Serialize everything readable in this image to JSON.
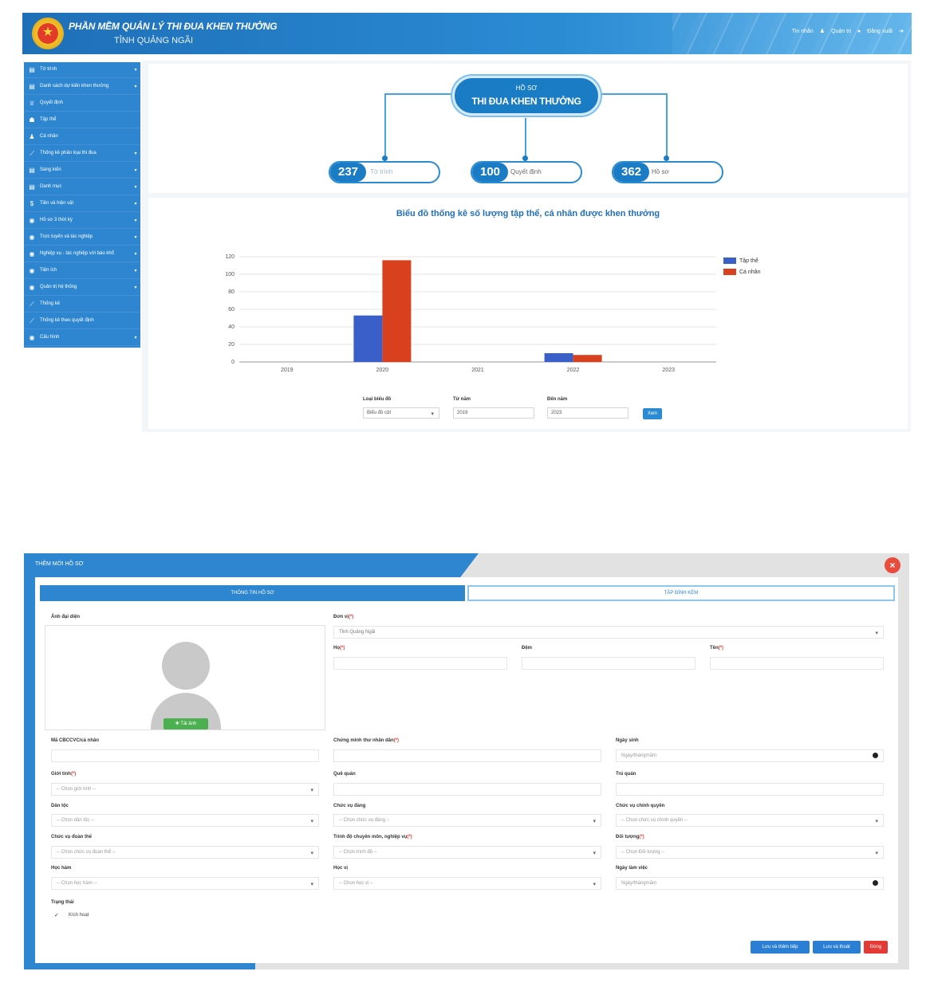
{
  "header": {
    "app_title": "PHẦN MỀM QUẢN LÝ THI ĐUA KHEN THƯỞNG",
    "app_subtitle": "TỈNH QUẢNG NGÃI",
    "nav": [
      "Tin nhắn",
      "Quản trị",
      "Đăng xuất"
    ]
  },
  "sidebar": {
    "items": [
      {
        "icon": "document-icon",
        "glyph": "▤",
        "label": "Tờ trình",
        "has_children": true
      },
      {
        "icon": "document-icon",
        "glyph": "▤",
        "label": "Danh sách dự kiến khen thưởng",
        "has_children": true
      },
      {
        "icon": "trophy-icon",
        "glyph": "♕",
        "label": "Quyết định",
        "has_children": false
      },
      {
        "icon": "group-icon",
        "glyph": "☗",
        "label": "Tập thể",
        "has_children": false
      },
      {
        "icon": "user-icon",
        "glyph": "♟",
        "label": "Cá nhân",
        "has_children": false
      },
      {
        "icon": "chart-icon",
        "glyph": "⟋",
        "label": "Thống kê phân loại thi đua",
        "has_children": true
      },
      {
        "icon": "file-icon",
        "glyph": "▤",
        "label": "Sáng kiến",
        "has_children": true
      },
      {
        "icon": "file-icon",
        "glyph": "▤",
        "label": "Danh mục",
        "has_children": true
      },
      {
        "icon": "dollar-icon",
        "glyph": "$",
        "label": "Tiền và hiện vật",
        "has_children": true
      },
      {
        "icon": "circle-icon",
        "glyph": "◉",
        "label": "Hồ sơ 3 thời kỳ",
        "has_children": true
      },
      {
        "icon": "circle-icon",
        "glyph": "◉",
        "label": "Trực tuyến và tác nghiệp",
        "has_children": true
      },
      {
        "icon": "circle-icon",
        "glyph": "◉",
        "label": "Nghiệp vụ - tác nghiệp với báo khổ",
        "has_children": true
      },
      {
        "icon": "circle-icon",
        "glyph": "◉",
        "label": "Tiện ích",
        "has_children": true
      },
      {
        "icon": "circle-icon",
        "glyph": "◉",
        "label": "Quản trị hệ thống",
        "has_children": true
      },
      {
        "icon": "chart-icon",
        "glyph": "⟋",
        "label": "Thống kê",
        "has_children": false
      },
      {
        "icon": "chart-icon",
        "glyph": "⟋",
        "label": "Thống kê theo quyết định",
        "has_children": false
      },
      {
        "icon": "circle-icon",
        "glyph": "◉",
        "label": "Cấu hình",
        "has_children": true
      }
    ]
  },
  "hero": {
    "line1": "HỒ SƠ",
    "line2": "THI ĐUA KHEN THƯỞNG",
    "stats": [
      {
        "value": "237",
        "label": "Tờ trình"
      },
      {
        "value": "100",
        "label": "Quyết định"
      },
      {
        "value": "362",
        "label": "Hồ sơ"
      }
    ]
  },
  "chart_data": {
    "type": "bar",
    "title": "Biểu đồ thống kê số lượng tập thể, cá nhân được khen thưởng",
    "categories": [
      "2019",
      "2020",
      "2021",
      "2022",
      "2023"
    ],
    "series": [
      {
        "name": "Tập thể",
        "color": "#3b5fc9",
        "values": [
          0,
          53,
          0,
          10,
          0
        ]
      },
      {
        "name": "Cá nhân",
        "color": "#d9411e",
        "values": [
          0,
          116,
          0,
          8,
          0
        ]
      }
    ],
    "yticks": [
      "0",
      "20",
      "40",
      "60",
      "80",
      "100",
      "120"
    ],
    "ylim": [
      0,
      120
    ],
    "grid": true,
    "legend_position": "top-right"
  },
  "chart_form": {
    "type_label": "Loại biểu đồ",
    "type_value": "Biểu đồ cột",
    "from_label": "Từ năm",
    "from_value": "2019",
    "to_label": "Đến năm",
    "to_value": "2023",
    "submit": "Xem"
  },
  "modal": {
    "title": "THÊM MỚI HỒ SƠ",
    "close": "×",
    "tabs": [
      "THÔNG TIN HỒ SƠ",
      "TẬP ĐÍNH KÈM"
    ],
    "avatar_label": "Ảnh đại diện",
    "upload_label": "✚ Tải ảnh",
    "fields": {
      "donvi": {
        "label": "Đơn vị",
        "req": "(*)",
        "value": "Tỉnh Quảng Ngãi"
      },
      "ho": {
        "label": "Họ",
        "req": "(*)"
      },
      "dem": {
        "label": "Đệm"
      },
      "ten": {
        "label": "Tên",
        "req": "(*)"
      },
      "ma": {
        "label": "Mã CBCCVC/cá nhân"
      },
      "cmnd": {
        "label": "Chứng minh thư nhân dân",
        "req": "(*)"
      },
      "ngaysinh": {
        "label": "Ngày sinh",
        "placeholder": "Ngày/tháng/năm"
      },
      "gioitinh": {
        "label": "Giới tính",
        "req": "(*)",
        "value": "-- Chọn giới tính --"
      },
      "quequan": {
        "label": "Quê quán"
      },
      "truquan": {
        "label": "Trú quán"
      },
      "dantoc": {
        "label": "Dân tộc",
        "value": "-- Chọn dân tộc --"
      },
      "chucvudang": {
        "label": "Chức vụ đảng",
        "value": "-- Chọn chức vụ đảng --"
      },
      "chucvuchinhquyen": {
        "label": "Chức vụ chính quyền",
        "value": "-- Chọn chức vụ chính quyền --"
      },
      "chucvudoanthe": {
        "label": "Chức vụ đoàn thể",
        "value": "-- Chọn chức vụ đoàn thể --"
      },
      "trinhdo": {
        "label": "Trình độ chuyên môn, nghiệp vụ",
        "req": "(*)",
        "value": "-- Chọn trình độ --"
      },
      "doituong": {
        "label": "Đối tượng",
        "req": "(*)",
        "value": "-- Chọn Đối tượng --"
      },
      "hamham": {
        "label": "Học hàm",
        "value": "-- Chọn học hàm --"
      },
      "hocvi": {
        "label": "Học vị",
        "value": "-- Chọn học vị --"
      },
      "ngaylamviec": {
        "label": "Ngày làm việc",
        "placeholder": "Ngày/tháng/năm"
      }
    },
    "status_label": "Trạng thái",
    "status_value": "Kích hoạt",
    "buttons": [
      "Lưu và thêm tiếp",
      "Lưu và thoát",
      "Đóng"
    ],
    "button_colors": [
      "#2a7fd4",
      "#2a7fd4",
      "#e53935"
    ]
  }
}
